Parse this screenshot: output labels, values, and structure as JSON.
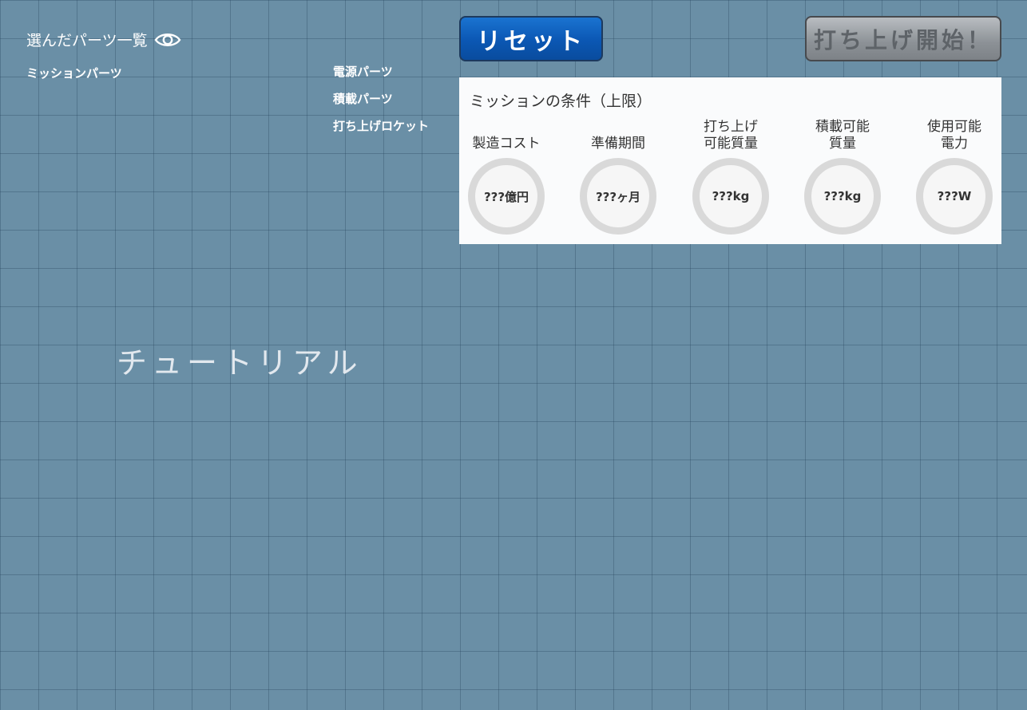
{
  "parts_list": {
    "title": "選んだパーツ一覧",
    "eye_icon": "eye-icon",
    "mission_parts_label": "ミッションパーツ",
    "categories": [
      "電源パーツ",
      "積載パーツ",
      "打ち上げロケット"
    ]
  },
  "toolbar": {
    "reset_label": "リセット",
    "launch_label": "打ち上げ開始！"
  },
  "conditions": {
    "title": "ミッションの条件（上限）",
    "metrics": [
      {
        "label": "製造コスト",
        "value": "???億円"
      },
      {
        "label": "準備期間",
        "value": "???ヶ月"
      },
      {
        "label": "打ち上げ\n可能質量",
        "value": "???kg"
      },
      {
        "label": "積載可能\n質量",
        "value": "???kg"
      },
      {
        "label": "使用可能\n電力",
        "value": "???W"
      }
    ]
  },
  "tutorial": {
    "label": "チュートリアル"
  },
  "colors": {
    "background": "#6a8fa6",
    "reset_button": "#0b57b3",
    "launch_button_disabled": "#8c9196",
    "panel": "#fafbfc",
    "gauge_ring": "#d9d9d9"
  }
}
